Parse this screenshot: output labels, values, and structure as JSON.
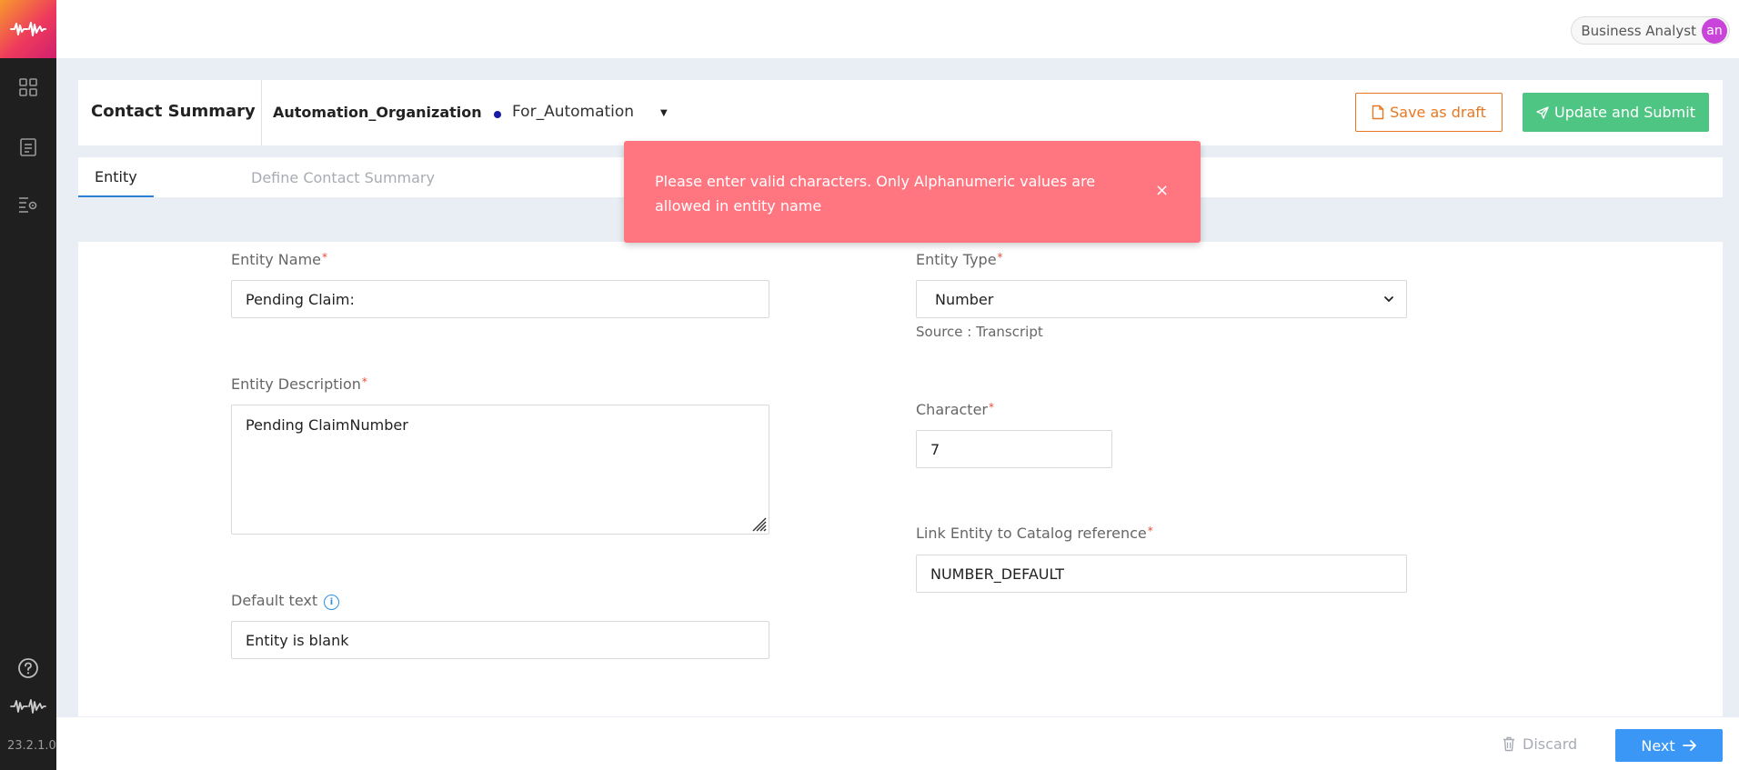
{
  "app": {
    "version": "23.2.1.0",
    "accent": "#ee3a5c"
  },
  "sidebar": {
    "items": [
      {
        "icon": "grid-icon"
      },
      {
        "icon": "document-icon"
      },
      {
        "icon": "settings-list-icon"
      }
    ],
    "bottom": [
      {
        "icon": "help-icon"
      },
      {
        "icon": "waveform-logo-icon"
      }
    ]
  },
  "topbar": {
    "user_role": "Business Analyst",
    "avatar_initials": "an"
  },
  "header": {
    "title": "Contact Summary",
    "organization": "Automation_Organization",
    "environment": "For_Automation",
    "save_draft_label": "Save as draft",
    "submit_label": "Update and Submit"
  },
  "tabs": [
    {
      "label": "Entity",
      "active": true
    },
    {
      "label": "Define Contact Summary",
      "active": false
    }
  ],
  "toast": {
    "message": "Please enter valid characters. Only Alphanumeric values are allowed in entity name",
    "close": "×",
    "color": "#ff7681"
  },
  "form": {
    "entity_name": {
      "label": "Entity Name",
      "value": "Pending Claim:"
    },
    "entity_description": {
      "label": "Entity Description",
      "value": "Pending ClaimNumber"
    },
    "default_text": {
      "label": "Default text",
      "value": "Entity is blank"
    },
    "entity_type": {
      "label": "Entity Type",
      "value": "Number",
      "source": "Source : Transcript"
    },
    "character": {
      "label": "Character",
      "value": "7"
    },
    "catalog_reference": {
      "label": "Link Entity to Catalog reference",
      "value": "NUMBER_DEFAULT"
    },
    "required_marker": "*"
  },
  "footer": {
    "discard_label": "Discard",
    "next_label": "Next"
  }
}
